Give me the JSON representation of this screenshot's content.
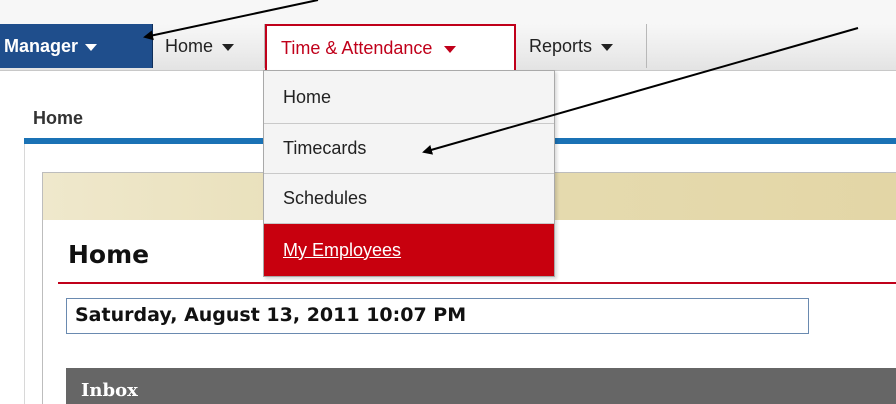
{
  "nav": {
    "manager_label": "Manager",
    "home_label": "Home",
    "time_attendance_label": "Time & Attendance",
    "reports_label": "Reports"
  },
  "dropdown": {
    "items": [
      {
        "label": "Home"
      },
      {
        "label": "Timecards"
      },
      {
        "label": "Schedules"
      },
      {
        "label": "My Employees"
      }
    ]
  },
  "page": {
    "breadcrumb": "Home",
    "title": "Home",
    "datetime": "Saturday, August 13, 2011 10:07 PM",
    "inbox_label": "Inbox"
  },
  "colors": {
    "manager_bg": "#1f4e8c",
    "accent_red": "#c0001a",
    "active_item_bg": "#c8000e",
    "section_rule_blue": "#1a72b5",
    "inbox_bg": "#666666"
  }
}
